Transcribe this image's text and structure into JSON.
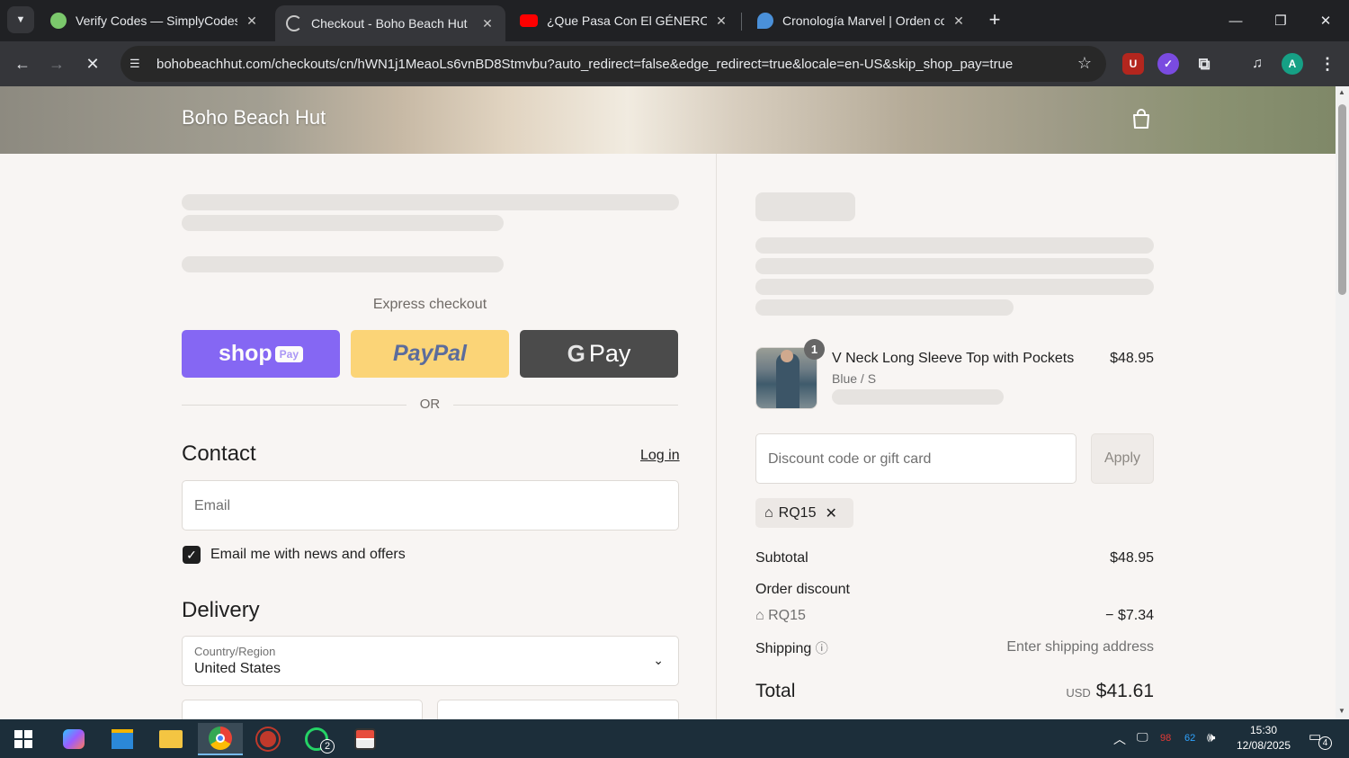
{
  "browser": {
    "tabs": [
      {
        "title": "Verify Codes — SimplyCodes",
        "favicon": "simplycodes-icon",
        "active": false
      },
      {
        "title": "Checkout - Boho Beach Hut",
        "favicon": "loading-icon",
        "active": true
      },
      {
        "title": "¿Que Pasa Con El GÉNERO DE S",
        "favicon": "youtube-icon",
        "active": false
      },
      {
        "title": "Cronología Marvel | Orden com",
        "favicon": "marvel-icon",
        "active": false
      }
    ],
    "url": "bohobeachhut.com/checkouts/cn/hWN1j1MeaoLs6vnBD8Stmvbu?auto_redirect=false&edge_redirect=true&locale=en-US&skip_shop_pay=true",
    "profile_initial": "A"
  },
  "store": {
    "name": "Boho Beach Hut"
  },
  "checkout": {
    "express_label": "Express checkout",
    "or_label": "OR",
    "shop_pay": {
      "shop": "shop",
      "pay": "Pay"
    },
    "paypal_label": "PayPal",
    "gpay_label": "Pay",
    "contact_heading": "Contact",
    "login_link": "Log in",
    "email_placeholder": "Email",
    "email_optin_label": "Email me with news and offers",
    "email_optin_checked": true,
    "delivery_heading": "Delivery",
    "country_label": "Country/Region",
    "country_value": "United States"
  },
  "summary": {
    "item": {
      "quantity": "1",
      "name": "V Neck Long Sleeve Top with Pockets",
      "variant": "Blue / S",
      "price": "$48.95"
    },
    "discount_placeholder": "Discount code or gift card",
    "apply_label": "Apply",
    "applied_code": "RQ15",
    "subtotal_label": "Subtotal",
    "subtotal_value": "$48.95",
    "order_discount_label": "Order discount",
    "order_discount_code": "RQ15",
    "order_discount_value": "− $7.34",
    "shipping_label": "Shipping",
    "shipping_value": "Enter shipping address",
    "total_label": "Total",
    "total_currency": "USD",
    "total_value": "$41.61"
  },
  "taskbar": {
    "whatsapp_badge": "2",
    "tray_num1": "98",
    "tray_num2": "62",
    "time": "15:30",
    "date": "12/08/2025",
    "notifications": "4"
  },
  "colors": {
    "page_bg": "#f8f5f3",
    "shop_pay": "#5a31f4",
    "paypal": "#fbd477",
    "gpay": "#4b4b4b",
    "chrome_dark": "#202124"
  }
}
